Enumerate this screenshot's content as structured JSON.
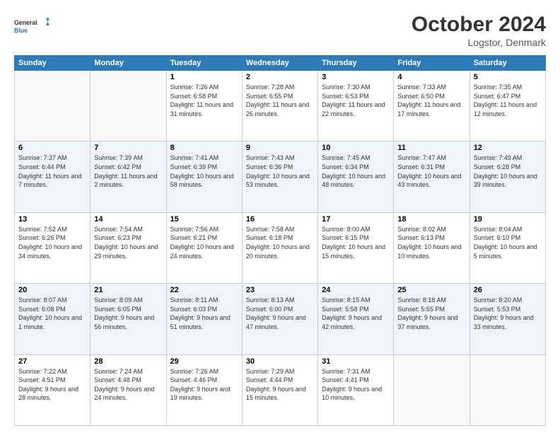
{
  "header": {
    "logo_line1": "General",
    "logo_line2": "Blue",
    "month_title": "October 2024",
    "location": "Logstor, Denmark"
  },
  "days_of_week": [
    "Sunday",
    "Monday",
    "Tuesday",
    "Wednesday",
    "Thursday",
    "Friday",
    "Saturday"
  ],
  "weeks": [
    [
      {
        "day": "",
        "info": ""
      },
      {
        "day": "",
        "info": ""
      },
      {
        "day": "1",
        "info": "Sunrise: 7:26 AM\nSunset: 6:58 PM\nDaylight: 11 hours and 31 minutes."
      },
      {
        "day": "2",
        "info": "Sunrise: 7:28 AM\nSunset: 6:55 PM\nDaylight: 11 hours and 26 minutes."
      },
      {
        "day": "3",
        "info": "Sunrise: 7:30 AM\nSunset: 6:53 PM\nDaylight: 11 hours and 22 minutes."
      },
      {
        "day": "4",
        "info": "Sunrise: 7:33 AM\nSunset: 6:50 PM\nDaylight: 11 hours and 17 minutes."
      },
      {
        "day": "5",
        "info": "Sunrise: 7:35 AM\nSunset: 6:47 PM\nDaylight: 11 hours and 12 minutes."
      }
    ],
    [
      {
        "day": "6",
        "info": "Sunrise: 7:37 AM\nSunset: 6:44 PM\nDaylight: 11 hours and 7 minutes."
      },
      {
        "day": "7",
        "info": "Sunrise: 7:39 AM\nSunset: 6:42 PM\nDaylight: 11 hours and 2 minutes."
      },
      {
        "day": "8",
        "info": "Sunrise: 7:41 AM\nSunset: 6:39 PM\nDaylight: 10 hours and 58 minutes."
      },
      {
        "day": "9",
        "info": "Sunrise: 7:43 AM\nSunset: 6:36 PM\nDaylight: 10 hours and 53 minutes."
      },
      {
        "day": "10",
        "info": "Sunrise: 7:45 AM\nSunset: 6:34 PM\nDaylight: 10 hours and 48 minutes."
      },
      {
        "day": "11",
        "info": "Sunrise: 7:47 AM\nSunset: 6:31 PM\nDaylight: 10 hours and 43 minutes."
      },
      {
        "day": "12",
        "info": "Sunrise: 7:49 AM\nSunset: 6:28 PM\nDaylight: 10 hours and 39 minutes."
      }
    ],
    [
      {
        "day": "13",
        "info": "Sunrise: 7:52 AM\nSunset: 6:26 PM\nDaylight: 10 hours and 34 minutes."
      },
      {
        "day": "14",
        "info": "Sunrise: 7:54 AM\nSunset: 6:23 PM\nDaylight: 10 hours and 29 minutes."
      },
      {
        "day": "15",
        "info": "Sunrise: 7:56 AM\nSunset: 6:21 PM\nDaylight: 10 hours and 24 minutes."
      },
      {
        "day": "16",
        "info": "Sunrise: 7:58 AM\nSunset: 6:18 PM\nDaylight: 10 hours and 20 minutes."
      },
      {
        "day": "17",
        "info": "Sunrise: 8:00 AM\nSunset: 6:15 PM\nDaylight: 10 hours and 15 minutes."
      },
      {
        "day": "18",
        "info": "Sunrise: 8:02 AM\nSunset: 6:13 PM\nDaylight: 10 hours and 10 minutes."
      },
      {
        "day": "19",
        "info": "Sunrise: 8:04 AM\nSunset: 6:10 PM\nDaylight: 10 hours and 5 minutes."
      }
    ],
    [
      {
        "day": "20",
        "info": "Sunrise: 8:07 AM\nSunset: 6:08 PM\nDaylight: 10 hours and 1 minute."
      },
      {
        "day": "21",
        "info": "Sunrise: 8:09 AM\nSunset: 6:05 PM\nDaylight: 9 hours and 56 minutes."
      },
      {
        "day": "22",
        "info": "Sunrise: 8:11 AM\nSunset: 6:03 PM\nDaylight: 9 hours and 51 minutes."
      },
      {
        "day": "23",
        "info": "Sunrise: 8:13 AM\nSunset: 6:00 PM\nDaylight: 9 hours and 47 minutes."
      },
      {
        "day": "24",
        "info": "Sunrise: 8:15 AM\nSunset: 5:58 PM\nDaylight: 9 hours and 42 minutes."
      },
      {
        "day": "25",
        "info": "Sunrise: 8:18 AM\nSunset: 5:55 PM\nDaylight: 9 hours and 37 minutes."
      },
      {
        "day": "26",
        "info": "Sunrise: 8:20 AM\nSunset: 5:53 PM\nDaylight: 9 hours and 33 minutes."
      }
    ],
    [
      {
        "day": "27",
        "info": "Sunrise: 7:22 AM\nSunset: 4:51 PM\nDaylight: 9 hours and 28 minutes."
      },
      {
        "day": "28",
        "info": "Sunrise: 7:24 AM\nSunset: 4:48 PM\nDaylight: 9 hours and 24 minutes."
      },
      {
        "day": "29",
        "info": "Sunrise: 7:26 AM\nSunset: 4:46 PM\nDaylight: 9 hours and 19 minutes."
      },
      {
        "day": "30",
        "info": "Sunrise: 7:29 AM\nSunset: 4:44 PM\nDaylight: 9 hours and 15 minutes."
      },
      {
        "day": "31",
        "info": "Sunrise: 7:31 AM\nSunset: 4:41 PM\nDaylight: 9 hours and 10 minutes."
      },
      {
        "day": "",
        "info": ""
      },
      {
        "day": "",
        "info": ""
      }
    ]
  ]
}
